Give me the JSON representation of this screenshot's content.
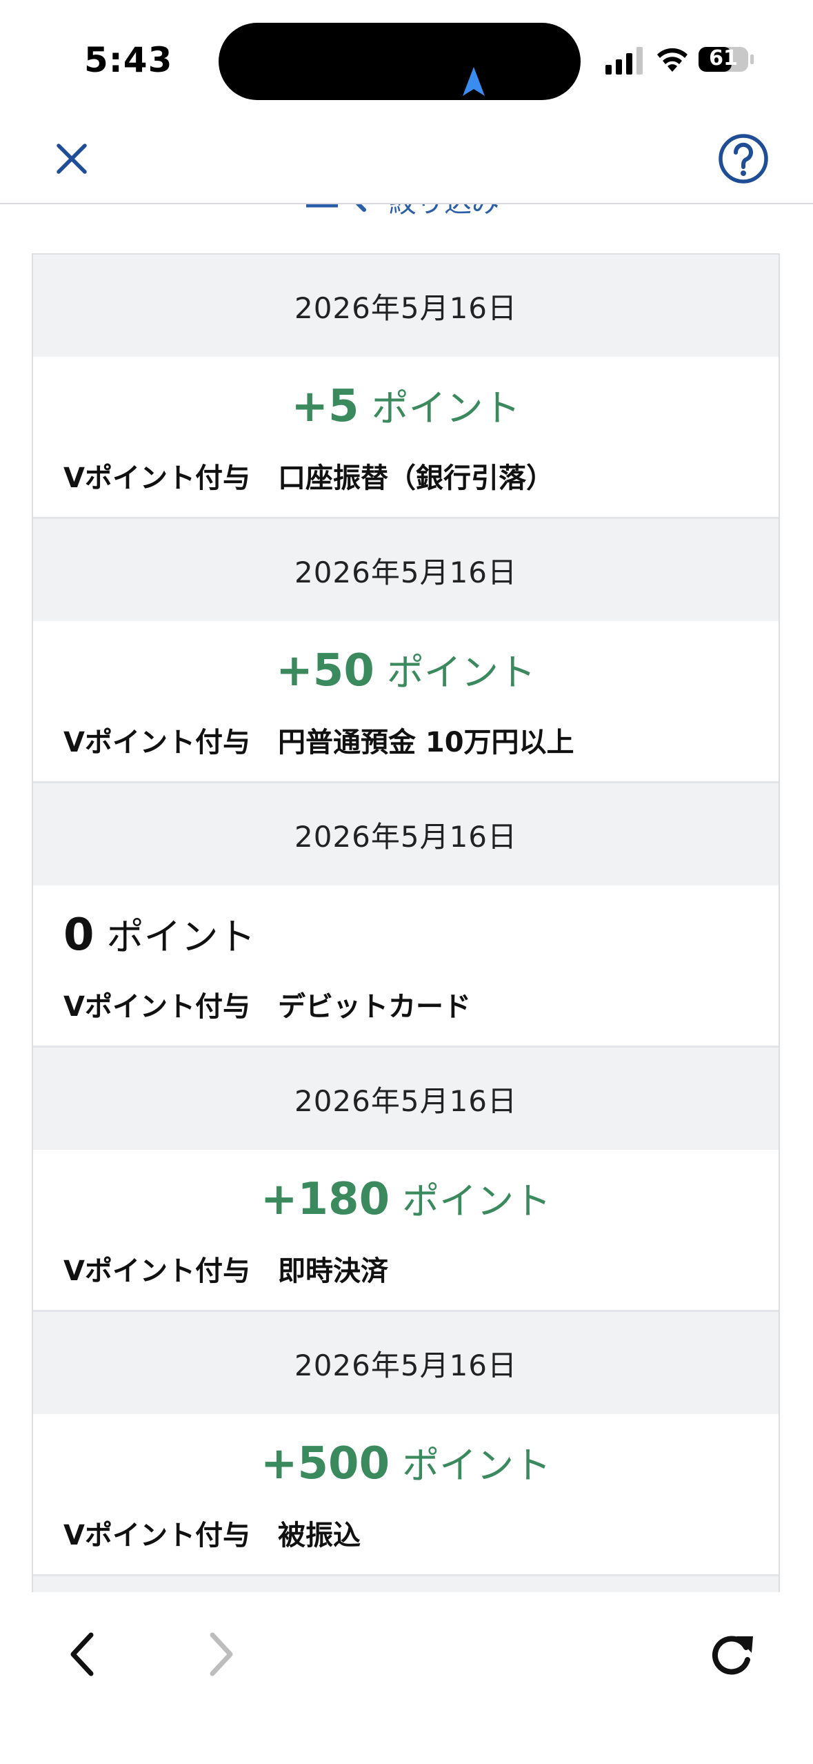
{
  "status_bar": {
    "time": "5:43",
    "battery": "61"
  },
  "header": {
    "close_icon": "close-icon",
    "help_icon": "help-icon"
  },
  "filter": {
    "label": "絞り込み",
    "icon": "filter-search-icon"
  },
  "colors": {
    "accent": "#2a5ea8",
    "positive_points": "#3a8a5e",
    "date_row_bg": "#f1f2f4"
  },
  "entries": [
    {
      "date": "2026年5月16日",
      "points": "+5",
      "unit": "ポイント",
      "positive": true,
      "label": "Vポイント付与",
      "detail": "口座振替（銀行引落）"
    },
    {
      "date": "2026年5月16日",
      "points": "+50",
      "unit": "ポイント",
      "positive": true,
      "label": "Vポイント付与",
      "detail": "円普通預金 10万円以上"
    },
    {
      "date": "2026年5月16日",
      "points": "0",
      "unit": "ポイント",
      "positive": false,
      "label": "Vポイント付与",
      "detail": "デビットカード"
    },
    {
      "date": "2026年5月16日",
      "points": "+180",
      "unit": "ポイント",
      "positive": true,
      "label": "Vポイント付与",
      "detail": "即時決済"
    },
    {
      "date": "2026年5月16日",
      "points": "+500",
      "unit": "ポイント",
      "positive": true,
      "label": "Vポイント付与",
      "detail": "被振込"
    }
  ],
  "toolbar": {
    "back_icon": "chevron-left-icon",
    "forward_icon": "chevron-right-icon",
    "reload_icon": "reload-icon"
  }
}
